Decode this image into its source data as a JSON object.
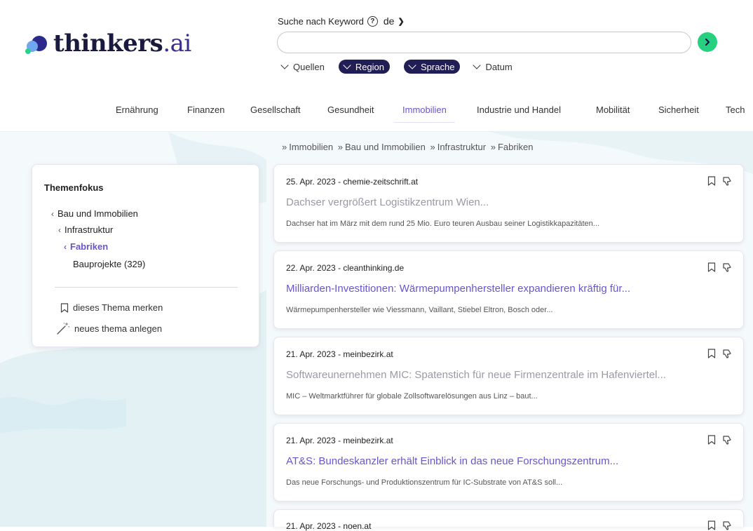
{
  "brand": {
    "name": "thinkers",
    "suffix": ".ai",
    "accent": "#6a55cc",
    "dark": "#211e55",
    "go_color": "#27d07e"
  },
  "search": {
    "label": "Suche nach Keyword",
    "help": "?",
    "language": "de",
    "value": "",
    "go_icon": "chevron-right-icon"
  },
  "filters": [
    {
      "label": "Quellen",
      "style": "plain"
    },
    {
      "label": "Region",
      "style": "pill"
    },
    {
      "label": "Sprache",
      "style": "pill"
    },
    {
      "label": "Datum",
      "style": "plain"
    }
  ],
  "nav": [
    {
      "label": "Ernährung"
    },
    {
      "label": "Finanzen"
    },
    {
      "label": "Gesellschaft"
    },
    {
      "label": "Gesundheit"
    },
    {
      "label": "Immobilien",
      "active": true
    },
    {
      "label": "Industrie und Handel"
    },
    {
      "label": "Mobilität"
    },
    {
      "label": "Sicherheit"
    },
    {
      "label": "Tech"
    }
  ],
  "breadcrumb": [
    "Immobilien",
    "Bau und Immobilien",
    "Infrastruktur",
    "Fabriken"
  ],
  "sidebar": {
    "title": "Themenfokus",
    "tree": [
      {
        "label": "Bau und Immobilien",
        "level": 0,
        "back": true
      },
      {
        "label": "Infrastruktur",
        "level": 1,
        "back": true
      },
      {
        "label": "Fabriken",
        "level": 2,
        "back": true,
        "current": true
      },
      {
        "label": "Bauprojekte (329)",
        "level": 3,
        "back": false
      }
    ],
    "actions": [
      {
        "label": "dieses Thema merken",
        "icon": "bookmark-icon"
      },
      {
        "label": "neues thema anlegen",
        "icon": "magic-wand-icon"
      }
    ]
  },
  "articles": [
    {
      "meta": "25. Apr. 2023 - chemie-zeitschrift.at",
      "title": "Dachser vergrößert Logistikzentrum Wien...",
      "excerpt": "Dachser hat im März mit dem rund 25 Mio. Euro teuren Ausbau seiner Logistikkapazitäten...",
      "visited": false
    },
    {
      "meta": "22. Apr. 2023 - cleanthinking.de",
      "title": "Milliarden-Investitionen: Wärmepumpenhersteller expandieren kräftig für...",
      "excerpt": "Wärmepumpenhersteller wie Viessmann, Vaillant, Stiebel Eltron, Bosch oder...",
      "visited": true
    },
    {
      "meta": "21. Apr. 2023 - meinbezirk.at",
      "title": "Softwareunernehmen MIC: Spatenstich für neue Firmenzentrale im Hafenviertel...",
      "excerpt": "MIC – Weltmarktführer für globale Zollsoftwarelösungen aus Linz – baut...",
      "visited": false
    },
    {
      "meta": "21. Apr. 2023 - meinbezirk.at",
      "title": "AT&S: Bundeskanzler erhält Einblick in das neue Forschungszentrum...",
      "excerpt": "Das neue Forschungs- und Produktionszentrum für IC-Substrate von AT&S soll...",
      "visited": true
    },
    {
      "meta": "21. Apr. 2023 - noen.at",
      "title": "",
      "excerpt": "",
      "visited": false
    }
  ]
}
